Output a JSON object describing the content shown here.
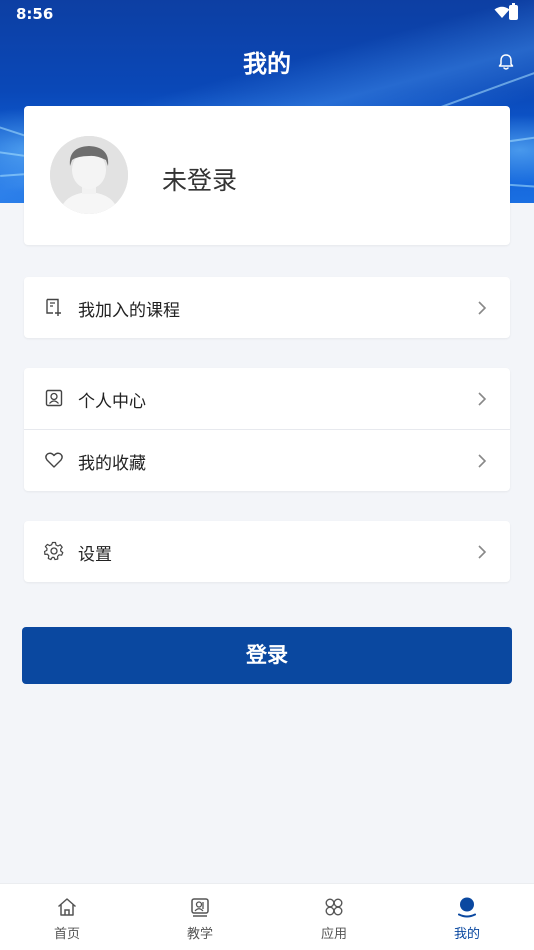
{
  "status_bar": {
    "time": "8:56"
  },
  "header": {
    "title": "我的",
    "notification_icon": "bell-icon"
  },
  "profile": {
    "name": "未登录",
    "avatar_icon": "default-avatar-icon"
  },
  "menu_groups": [
    {
      "items": [
        {
          "label": "我加入的课程",
          "icon": "course-book-icon"
        }
      ]
    },
    {
      "items": [
        {
          "label": "个人中心",
          "icon": "user-card-icon"
        },
        {
          "label": "我的收藏",
          "icon": "heart-icon"
        }
      ]
    },
    {
      "items": [
        {
          "label": "设置",
          "icon": "gear-icon"
        }
      ]
    }
  ],
  "login_button": {
    "label": "登录"
  },
  "tabbar": {
    "active_index": 3,
    "tabs": [
      {
        "label": "首页",
        "icon": "home-icon"
      },
      {
        "label": "教学",
        "icon": "teaching-icon"
      },
      {
        "label": "应用",
        "icon": "apps-icon"
      },
      {
        "label": "我的",
        "icon": "profile-icon"
      }
    ]
  },
  "colors": {
    "primary": "#0a48a0",
    "background": "#f3f5f9",
    "header_blue": "#0a48b8"
  }
}
